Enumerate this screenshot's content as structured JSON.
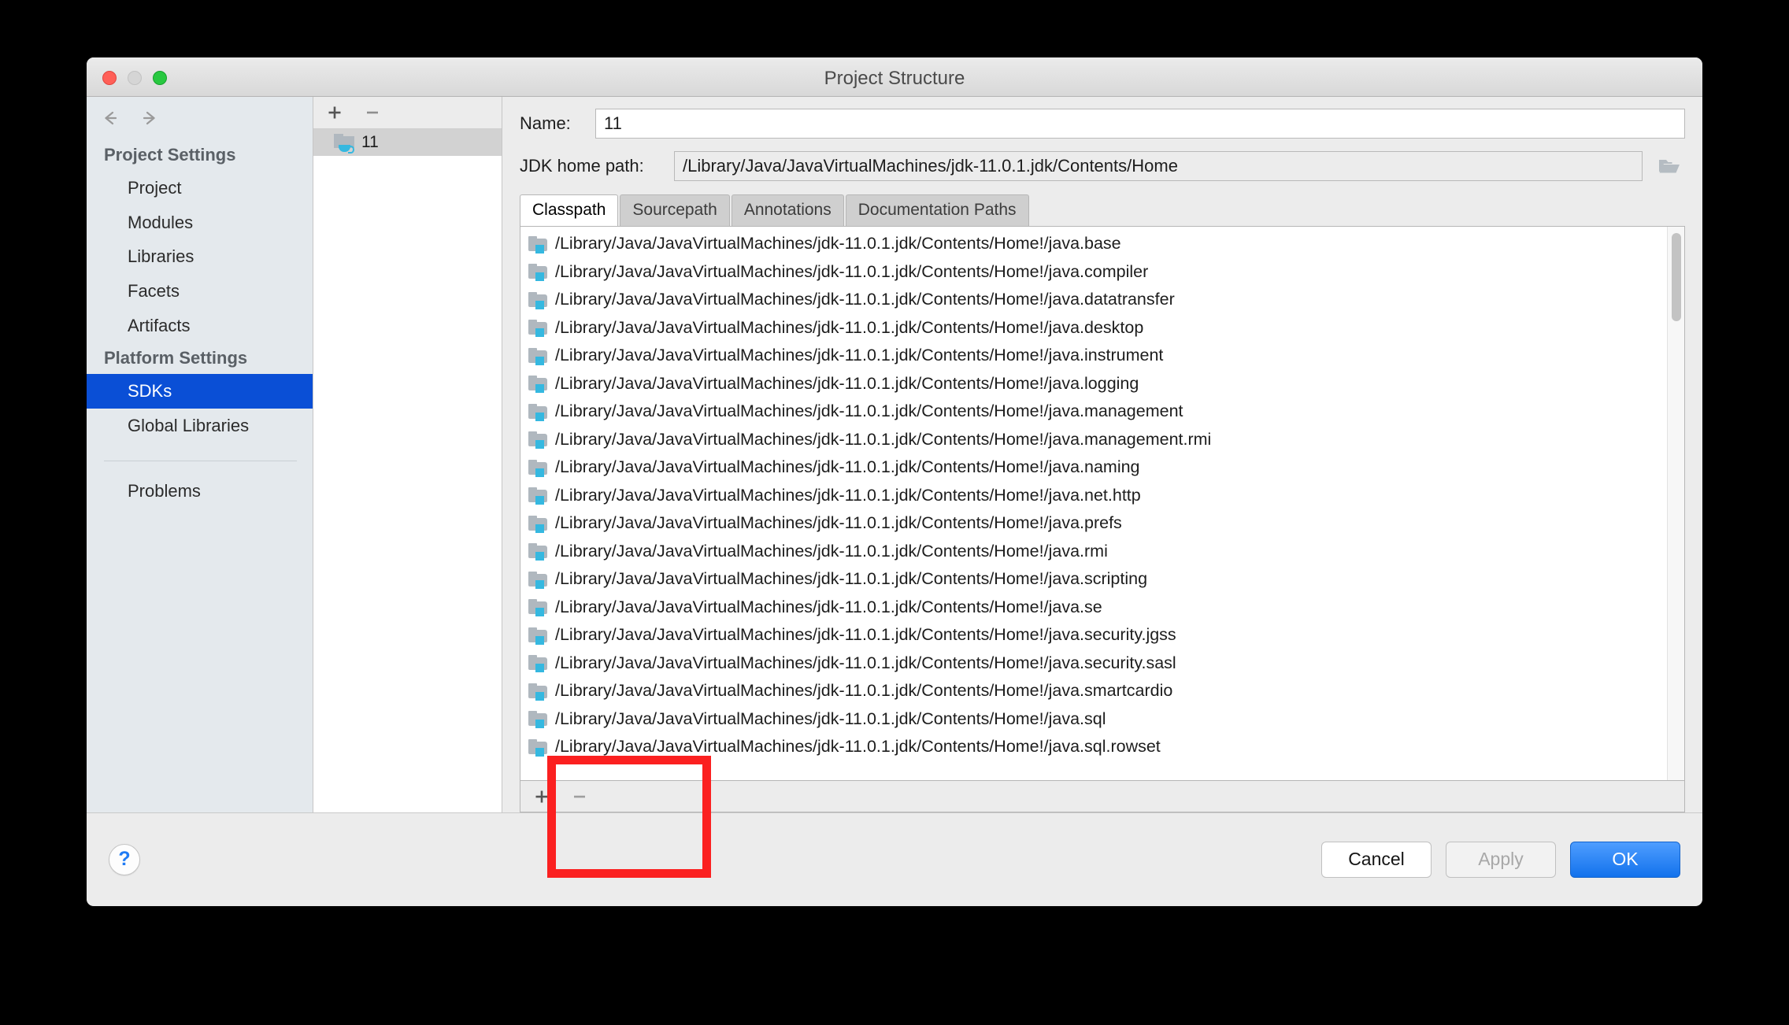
{
  "window": {
    "title": "Project Structure",
    "traffic_lights": [
      "close",
      "minimize",
      "maximize"
    ]
  },
  "sidebar": {
    "back_icon": "back-arrow-icon",
    "forward_icon": "forward-arrow-icon",
    "groups": [
      {
        "header": "Project Settings",
        "items": [
          {
            "label": "Project",
            "selected": false
          },
          {
            "label": "Modules",
            "selected": false
          },
          {
            "label": "Libraries",
            "selected": false
          },
          {
            "label": "Facets",
            "selected": false
          },
          {
            "label": "Artifacts",
            "selected": false
          }
        ]
      },
      {
        "header": "Platform Settings",
        "items": [
          {
            "label": "SDKs",
            "selected": true
          },
          {
            "label": "Global Libraries",
            "selected": false
          }
        ]
      }
    ],
    "extra_items": [
      {
        "label": "Problems",
        "selected": false
      }
    ]
  },
  "sdk_panel": {
    "add_label": "+",
    "remove_label": "−",
    "items": [
      {
        "label": "11",
        "selected": true,
        "icon": "jdk-folder-icon"
      }
    ]
  },
  "detail": {
    "name_label": "Name:",
    "name_value": "11",
    "path_label": "JDK home path:",
    "path_value": "/Library/Java/JavaVirtualMachines/jdk-11.0.1.jdk/Contents/Home",
    "browse_icon": "folder-open-icon",
    "tabs": [
      {
        "label": "Classpath",
        "active": true
      },
      {
        "label": "Sourcepath",
        "active": false
      },
      {
        "label": "Annotations",
        "active": false
      },
      {
        "label": "Documentation Paths",
        "active": false
      }
    ],
    "classpath_toolbar": {
      "add_label": "+",
      "remove_label": "−"
    },
    "classpath_prefix": "/Library/Java/JavaVirtualMachines/jdk-11.0.1.jdk/Contents/Home!/",
    "classpath_entries": [
      "/Library/Java/JavaVirtualMachines/jdk-11.0.1.jdk/Contents/Home!/java.base",
      "/Library/Java/JavaVirtualMachines/jdk-11.0.1.jdk/Contents/Home!/java.compiler",
      "/Library/Java/JavaVirtualMachines/jdk-11.0.1.jdk/Contents/Home!/java.datatransfer",
      "/Library/Java/JavaVirtualMachines/jdk-11.0.1.jdk/Contents/Home!/java.desktop",
      "/Library/Java/JavaVirtualMachines/jdk-11.0.1.jdk/Contents/Home!/java.instrument",
      "/Library/Java/JavaVirtualMachines/jdk-11.0.1.jdk/Contents/Home!/java.logging",
      "/Library/Java/JavaVirtualMachines/jdk-11.0.1.jdk/Contents/Home!/java.management",
      "/Library/Java/JavaVirtualMachines/jdk-11.0.1.jdk/Contents/Home!/java.management.rmi",
      "/Library/Java/JavaVirtualMachines/jdk-11.0.1.jdk/Contents/Home!/java.naming",
      "/Library/Java/JavaVirtualMachines/jdk-11.0.1.jdk/Contents/Home!/java.net.http",
      "/Library/Java/JavaVirtualMachines/jdk-11.0.1.jdk/Contents/Home!/java.prefs",
      "/Library/Java/JavaVirtualMachines/jdk-11.0.1.jdk/Contents/Home!/java.rmi",
      "/Library/Java/JavaVirtualMachines/jdk-11.0.1.jdk/Contents/Home!/java.scripting",
      "/Library/Java/JavaVirtualMachines/jdk-11.0.1.jdk/Contents/Home!/java.se",
      "/Library/Java/JavaVirtualMachines/jdk-11.0.1.jdk/Contents/Home!/java.security.jgss",
      "/Library/Java/JavaVirtualMachines/jdk-11.0.1.jdk/Contents/Home!/java.security.sasl",
      "/Library/Java/JavaVirtualMachines/jdk-11.0.1.jdk/Contents/Home!/java.smartcardio",
      "/Library/Java/JavaVirtualMachines/jdk-11.0.1.jdk/Contents/Home!/java.sql",
      "/Library/Java/JavaVirtualMachines/jdk-11.0.1.jdk/Contents/Home!/java.sql.rowset"
    ]
  },
  "footer": {
    "help_label": "?",
    "cancel_label": "Cancel",
    "apply_label": "Apply",
    "ok_label": "OK"
  },
  "colors": {
    "selection_blue": "#0a4fd6",
    "primary_button": "#1272ec",
    "annotation_red": "#fb2020",
    "icon_badge": "#35b8e0"
  }
}
